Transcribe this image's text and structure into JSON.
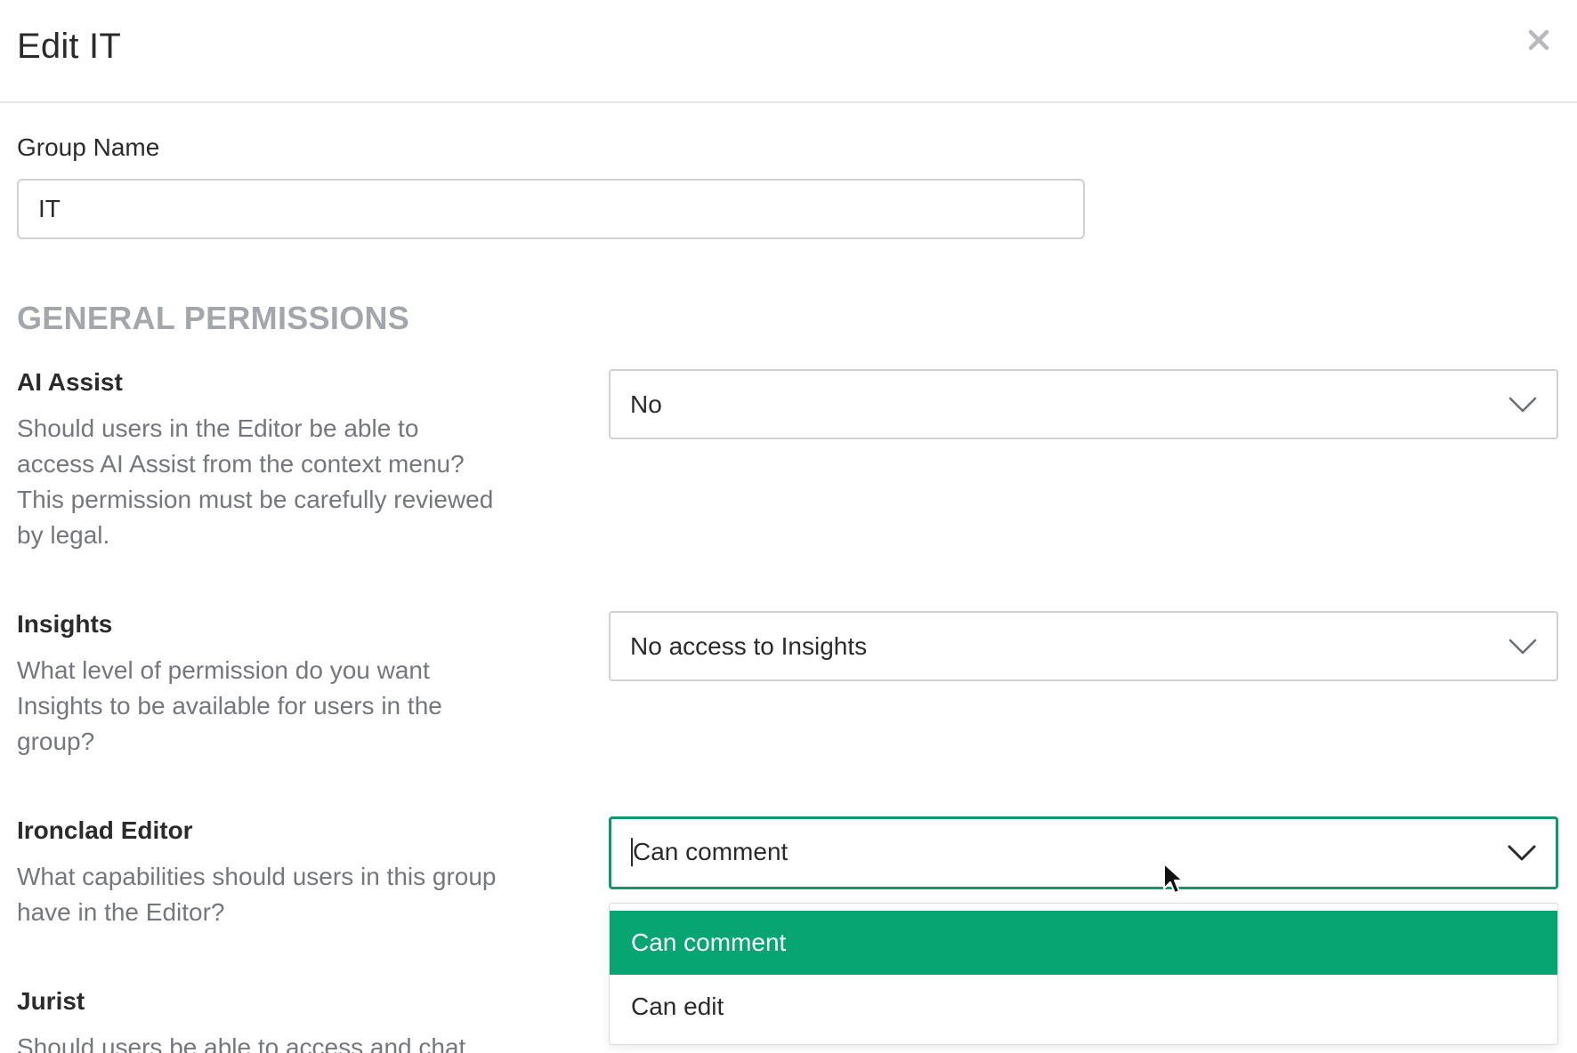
{
  "modal": {
    "title": "Edit IT",
    "close_icon": "close-icon"
  },
  "group_name": {
    "label": "Group Name",
    "value": "IT"
  },
  "section": {
    "title": "GENERAL PERMISSIONS"
  },
  "permissions": [
    {
      "title": "AI Assist",
      "description": "Should users in the Editor be able to access AI Assist from the context menu? This permission must be carefully reviewed by legal.",
      "value": "No"
    },
    {
      "title": "Insights",
      "description": "What level of permission do you want Insights to be available for users in the group?",
      "value": "No access to Insights"
    },
    {
      "title": "Ironclad Editor",
      "description": "What capabilities should users in this group have in the Editor?",
      "value": "Can comment",
      "options": [
        "Can comment",
        "Can edit"
      ],
      "highlighted_option": "Can comment"
    },
    {
      "title": "Jurist",
      "description": "Should users be able to access and chat"
    }
  ],
  "colors": {
    "accent": "#06a571",
    "focus_border": "#0a9a6b",
    "section_title": "#a3a6ab",
    "description_text": "#74777c"
  },
  "icons": {
    "close": "close-icon",
    "chevron": "chevron-down-icon",
    "cursor": "mouse-pointer-icon"
  }
}
